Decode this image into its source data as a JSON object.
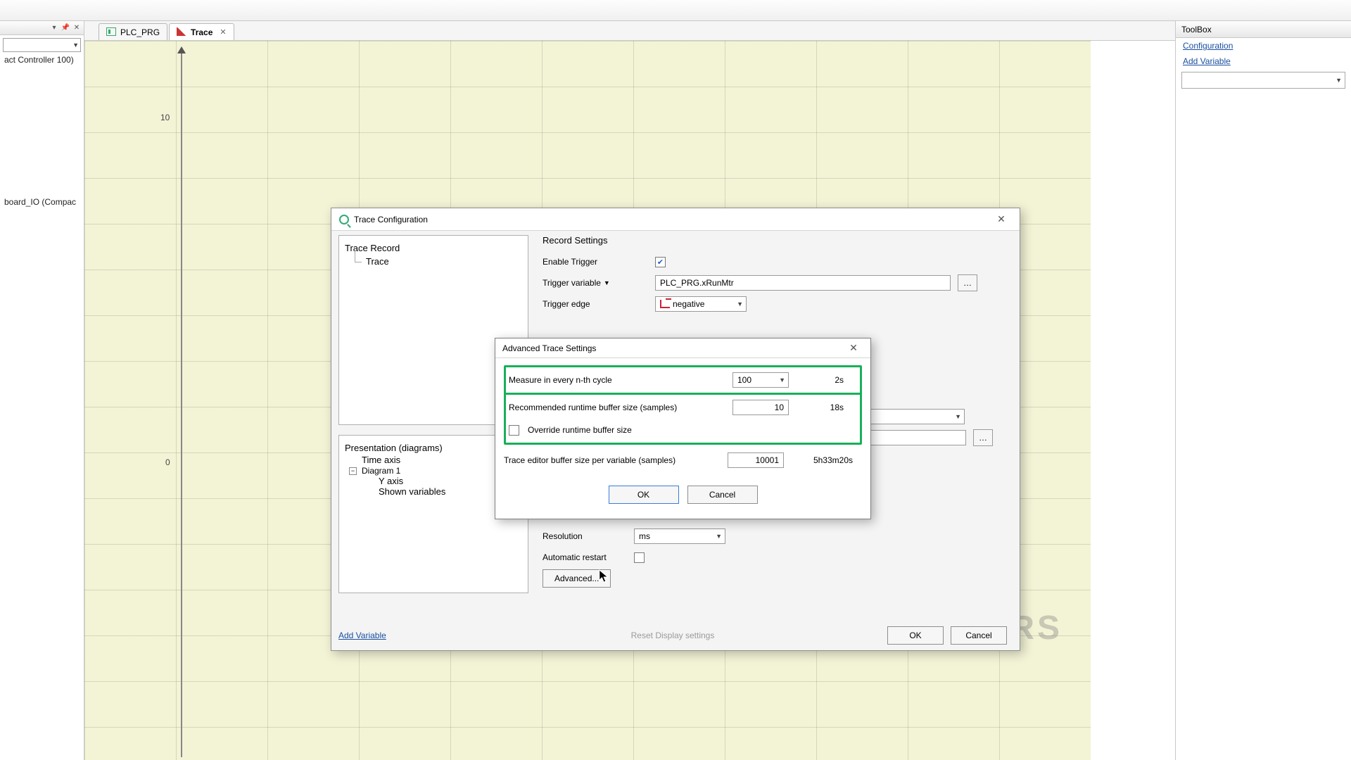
{
  "tabs": {
    "plc": "PLC_PRG",
    "trace": "Trace"
  },
  "left_tree": {
    "item1": "act Controller 100)",
    "item2": "board_IO (Compac"
  },
  "toolbox": {
    "title": "ToolBox",
    "link_config": "Configuration",
    "link_addvar": "Add Variable"
  },
  "axis": {
    "y10": "10",
    "y0": "0"
  },
  "watermark": "REALPARS",
  "trace_config": {
    "title": "Trace Configuration",
    "tree_root": "Trace Record",
    "tree_child": "Trace",
    "presentation_root": "Presentation (diagrams)",
    "pres_timeaxis": "Time axis",
    "pres_diagram": "Diagram 1",
    "pres_yaxis": "Y axis",
    "pres_shown": "Shown variables",
    "section_record": "Record Settings",
    "lbl_enable_trigger": "Enable Trigger",
    "lbl_trigger_var": "Trigger variable",
    "val_trigger_var": "PLC_PRG.xRunMtr",
    "lbl_trigger_edge": "Trigger edge",
    "val_trigger_edge": "negative",
    "lbl_resolution": "Resolution",
    "val_resolution": "ms",
    "lbl_auto_restart": "Automatic restart",
    "btn_advanced": "Advanced...",
    "link_addvar": "Add Variable",
    "link_reset": "Reset Display settings",
    "btn_ok": "OK",
    "btn_cancel": "Cancel"
  },
  "adv": {
    "title": "Advanced Trace Settings",
    "lbl_measure": "Measure in every n-th cycle",
    "val_measure": "100",
    "time_measure": "2s",
    "lbl_recbuf": "Recommended runtime buffer size (samples)",
    "val_recbuf": "10",
    "time_recbuf": "18s",
    "lbl_override": "Override runtime buffer size",
    "lbl_editorbuf": "Trace editor buffer size per variable (samples)",
    "val_editorbuf": "10001",
    "time_editorbuf": "5h33m20s",
    "btn_ok": "OK",
    "btn_cancel": "Cancel"
  }
}
